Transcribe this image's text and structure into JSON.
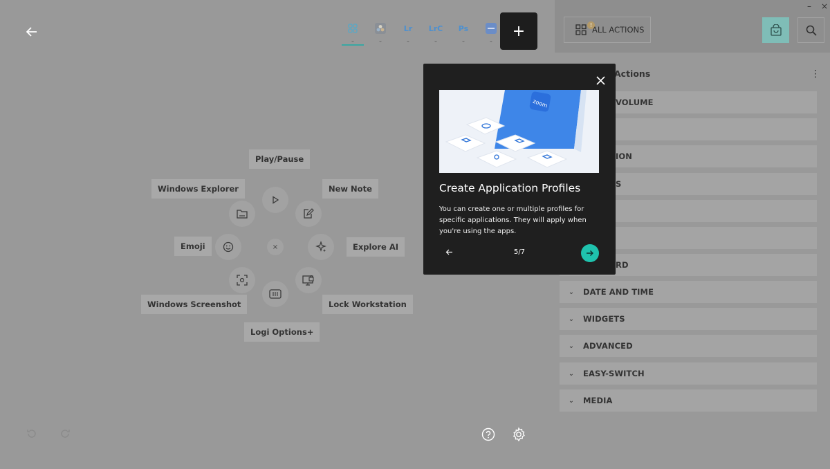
{
  "tabs": [
    {
      "name": "all-apps",
      "icon": "grid-icon",
      "label": ""
    },
    {
      "name": "davinci",
      "icon": "davinci-icon",
      "label": ""
    },
    {
      "name": "lightroom",
      "icon": "lr-icon",
      "label": "Lr"
    },
    {
      "name": "lightroom-classic",
      "icon": "lrc-icon",
      "label": "LrC"
    },
    {
      "name": "photoshop",
      "icon": "ps-icon",
      "label": "Ps"
    },
    {
      "name": "other-app",
      "icon": "app-icon",
      "label": ""
    }
  ],
  "add_app_label": "+",
  "radial": {
    "play_pause": "Play/Pause",
    "windows_explorer": "Windows Explorer",
    "new_note": "New Note",
    "emoji": "Emoji",
    "explore_ai": "Explore AI",
    "windows_screenshot": "Windows Screenshot",
    "lock_workstation": "Lock Workstation",
    "logi_options": "Logi Options+",
    "center": "×"
  },
  "right_panel": {
    "all_actions": "ALL ACTIONS",
    "badge": "!",
    "actions_title": "Actions",
    "categories": [
      {
        "label": "VOLUME",
        "visible": "VOLUME"
      },
      {
        "label": "",
        "visible": ""
      },
      {
        "label": "ION",
        "visible": "ION"
      },
      {
        "label": "S",
        "visible": "S"
      },
      {
        "label": "",
        "visible": ""
      },
      {
        "label": "",
        "visible": ""
      },
      {
        "label": "RD",
        "visible": "RD"
      },
      {
        "label": "DATE AND TIME",
        "visible": "DATE AND TIME"
      },
      {
        "label": "WIDGETS",
        "visible": "WIDGETS"
      },
      {
        "label": "ADVANCED",
        "visible": "ADVANCED"
      },
      {
        "label": "EASY-SWITCH",
        "visible": "EASY-SWITCH"
      },
      {
        "label": "MEDIA",
        "visible": "MEDIA"
      }
    ]
  },
  "popup": {
    "image_brand": "zoom",
    "title": "Create Application Profiles",
    "body": "You can create one or multiple profiles for specific applications. They will apply when you're using the apps.",
    "page": "5/7"
  },
  "colors": {
    "accent": "#1fc2ad",
    "overlay": "#999999",
    "popup_bg": "#1f1f1f"
  }
}
